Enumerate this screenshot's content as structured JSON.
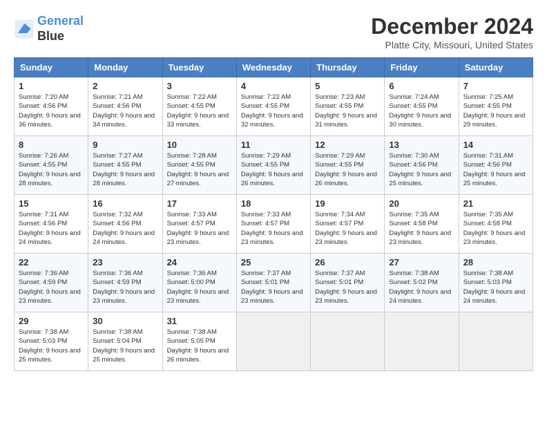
{
  "logo": {
    "line1": "General",
    "line2": "Blue"
  },
  "title": "December 2024",
  "subtitle": "Platte City, Missouri, United States",
  "days": [
    "Sunday",
    "Monday",
    "Tuesday",
    "Wednesday",
    "Thursday",
    "Friday",
    "Saturday"
  ],
  "weeks": [
    [
      {
        "day": "1",
        "sunrise": "7:20 AM",
        "sunset": "4:56 PM",
        "daylight": "9 hours and 36 minutes."
      },
      {
        "day": "2",
        "sunrise": "7:21 AM",
        "sunset": "4:56 PM",
        "daylight": "9 hours and 34 minutes."
      },
      {
        "day": "3",
        "sunrise": "7:22 AM",
        "sunset": "4:55 PM",
        "daylight": "9 hours and 33 minutes."
      },
      {
        "day": "4",
        "sunrise": "7:22 AM",
        "sunset": "4:55 PM",
        "daylight": "9 hours and 32 minutes."
      },
      {
        "day": "5",
        "sunrise": "7:23 AM",
        "sunset": "4:55 PM",
        "daylight": "9 hours and 31 minutes."
      },
      {
        "day": "6",
        "sunrise": "7:24 AM",
        "sunset": "4:55 PM",
        "daylight": "9 hours and 30 minutes."
      },
      {
        "day": "7",
        "sunrise": "7:25 AM",
        "sunset": "4:55 PM",
        "daylight": "9 hours and 29 minutes."
      }
    ],
    [
      {
        "day": "8",
        "sunrise": "7:26 AM",
        "sunset": "4:55 PM",
        "daylight": "9 hours and 28 minutes."
      },
      {
        "day": "9",
        "sunrise": "7:27 AM",
        "sunset": "4:55 PM",
        "daylight": "9 hours and 28 minutes."
      },
      {
        "day": "10",
        "sunrise": "7:28 AM",
        "sunset": "4:55 PM",
        "daylight": "9 hours and 27 minutes."
      },
      {
        "day": "11",
        "sunrise": "7:29 AM",
        "sunset": "4:55 PM",
        "daylight": "9 hours and 26 minutes."
      },
      {
        "day": "12",
        "sunrise": "7:29 AM",
        "sunset": "4:55 PM",
        "daylight": "9 hours and 26 minutes."
      },
      {
        "day": "13",
        "sunrise": "7:30 AM",
        "sunset": "4:56 PM",
        "daylight": "9 hours and 25 minutes."
      },
      {
        "day": "14",
        "sunrise": "7:31 AM",
        "sunset": "4:56 PM",
        "daylight": "9 hours and 25 minutes."
      }
    ],
    [
      {
        "day": "15",
        "sunrise": "7:31 AM",
        "sunset": "4:56 PM",
        "daylight": "9 hours and 24 minutes."
      },
      {
        "day": "16",
        "sunrise": "7:32 AM",
        "sunset": "4:56 PM",
        "daylight": "9 hours and 24 minutes."
      },
      {
        "day": "17",
        "sunrise": "7:33 AM",
        "sunset": "4:57 PM",
        "daylight": "9 hours and 23 minutes."
      },
      {
        "day": "18",
        "sunrise": "7:33 AM",
        "sunset": "4:57 PM",
        "daylight": "9 hours and 23 minutes."
      },
      {
        "day": "19",
        "sunrise": "7:34 AM",
        "sunset": "4:57 PM",
        "daylight": "9 hours and 23 minutes."
      },
      {
        "day": "20",
        "sunrise": "7:35 AM",
        "sunset": "4:58 PM",
        "daylight": "9 hours and 23 minutes."
      },
      {
        "day": "21",
        "sunrise": "7:35 AM",
        "sunset": "4:58 PM",
        "daylight": "9 hours and 23 minutes."
      }
    ],
    [
      {
        "day": "22",
        "sunrise": "7:36 AM",
        "sunset": "4:59 PM",
        "daylight": "9 hours and 23 minutes."
      },
      {
        "day": "23",
        "sunrise": "7:36 AM",
        "sunset": "4:59 PM",
        "daylight": "9 hours and 23 minutes."
      },
      {
        "day": "24",
        "sunrise": "7:36 AM",
        "sunset": "5:00 PM",
        "daylight": "9 hours and 23 minutes."
      },
      {
        "day": "25",
        "sunrise": "7:37 AM",
        "sunset": "5:01 PM",
        "daylight": "9 hours and 23 minutes."
      },
      {
        "day": "26",
        "sunrise": "7:37 AM",
        "sunset": "5:01 PM",
        "daylight": "9 hours and 23 minutes."
      },
      {
        "day": "27",
        "sunrise": "7:38 AM",
        "sunset": "5:02 PM",
        "daylight": "9 hours and 24 minutes."
      },
      {
        "day": "28",
        "sunrise": "7:38 AM",
        "sunset": "5:03 PM",
        "daylight": "9 hours and 24 minutes."
      }
    ],
    [
      {
        "day": "29",
        "sunrise": "7:38 AM",
        "sunset": "5:03 PM",
        "daylight": "9 hours and 25 minutes."
      },
      {
        "day": "30",
        "sunrise": "7:38 AM",
        "sunset": "5:04 PM",
        "daylight": "9 hours and 25 minutes."
      },
      {
        "day": "31",
        "sunrise": "7:38 AM",
        "sunset": "5:05 PM",
        "daylight": "9 hours and 26 minutes."
      },
      null,
      null,
      null,
      null
    ]
  ]
}
